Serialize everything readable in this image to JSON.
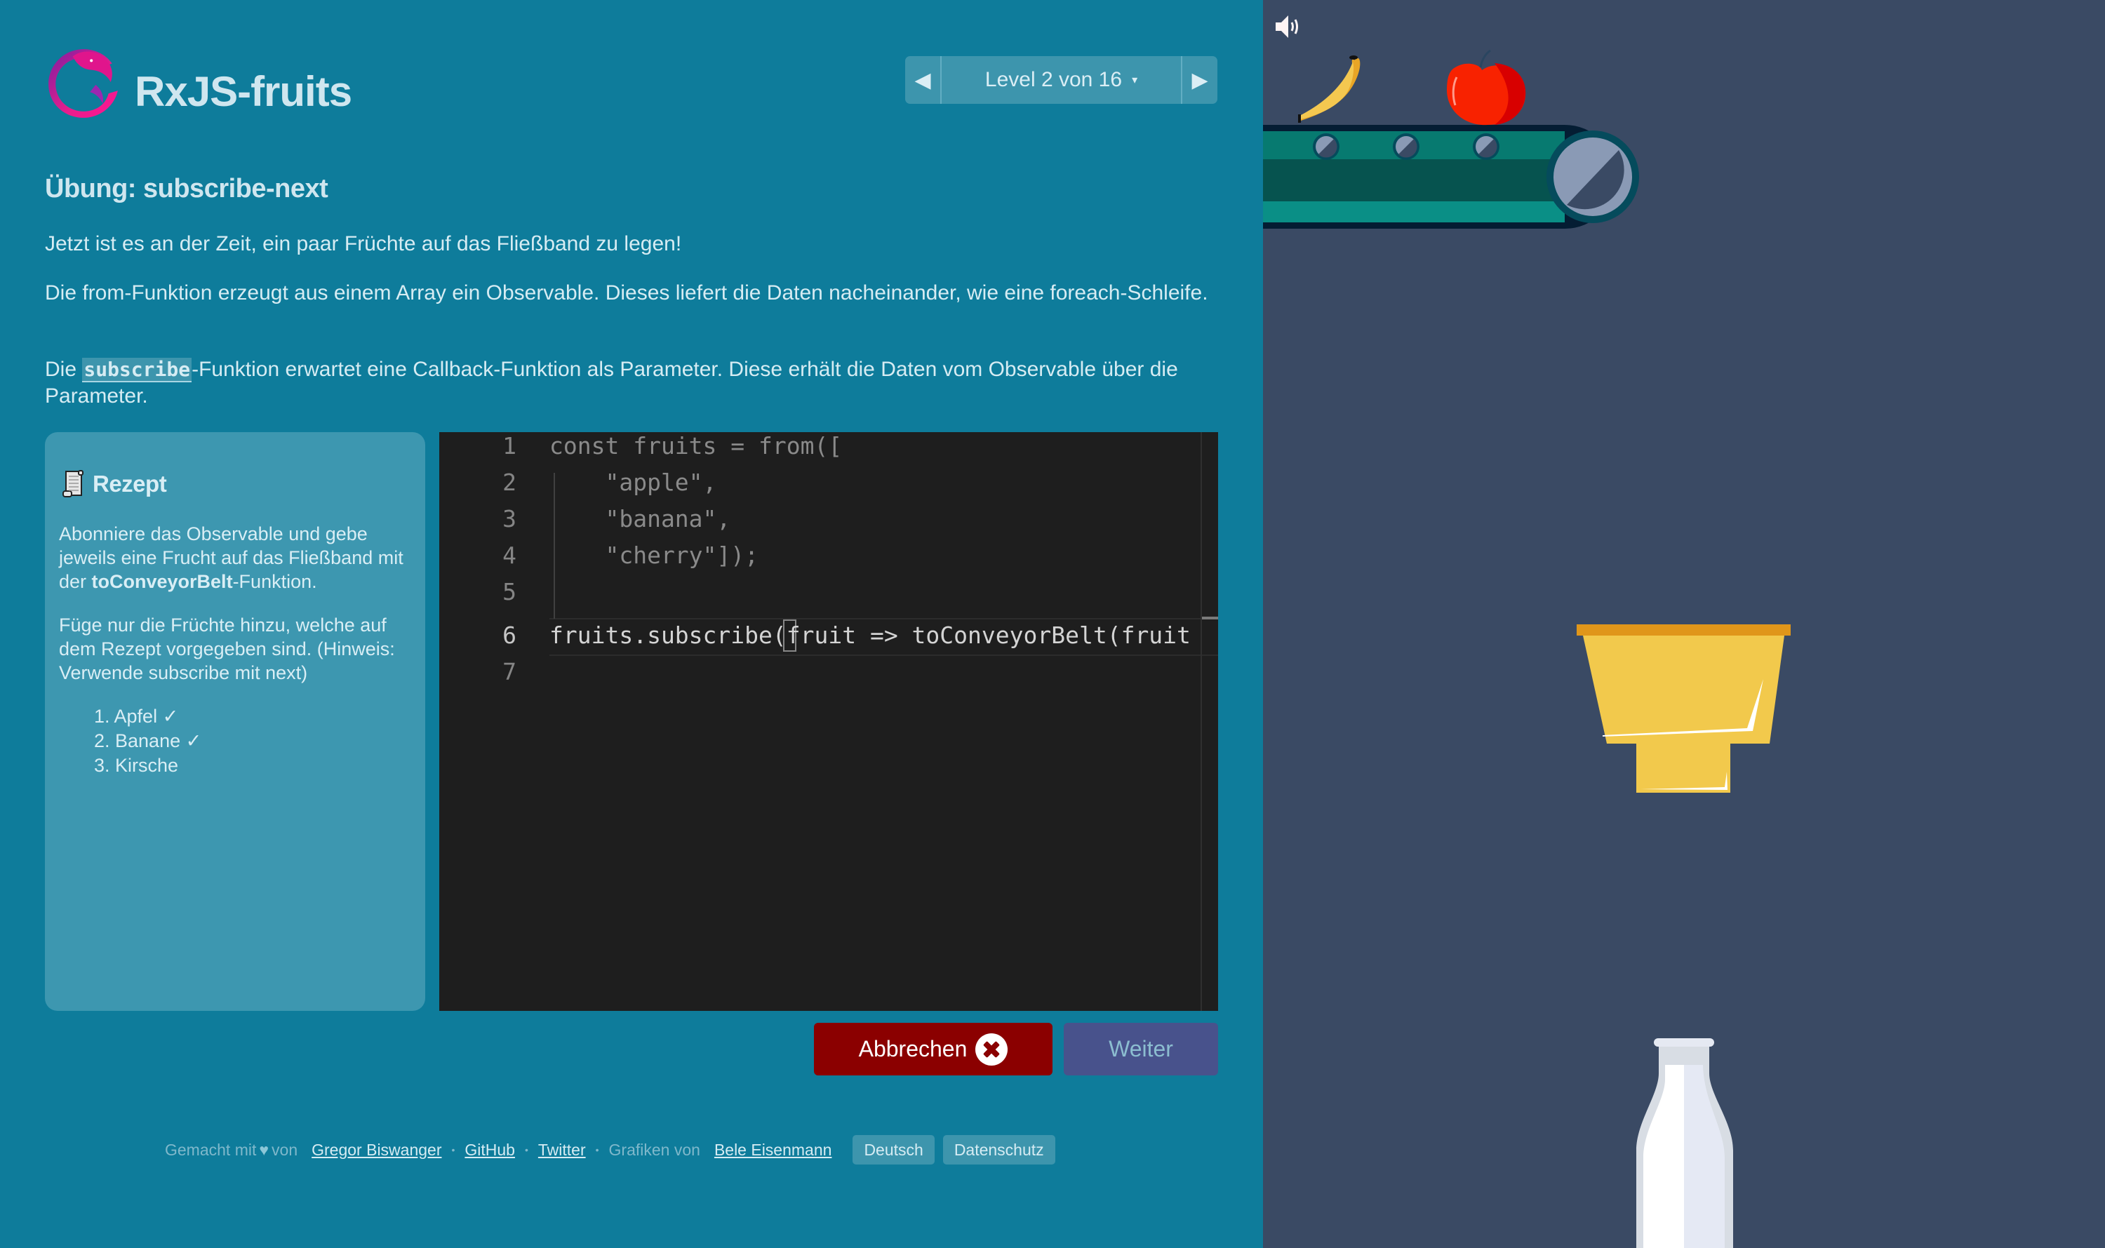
{
  "app": {
    "title": "RxJS-fruits",
    "logo": "rxjs-logo"
  },
  "level_selector": {
    "prev_icon": "triangle-left-icon",
    "label": "Level 2 von 16",
    "caret": "▾",
    "next_icon": "triangle-right-icon"
  },
  "exercise": {
    "title": "Übung: subscribe-next",
    "paragraph1": "Jetzt ist es an der Zeit, ein paar Früchte auf das Fließband zu legen!",
    "paragraph2": "Die from-Funktion erzeugt aus einem Array ein Observable. Dieses liefert die Daten nacheinander, wie eine foreach-Schleife.",
    "paragraph3_prefix": "Die ",
    "paragraph3_code": "subscribe",
    "paragraph3_suffix": "-Funktion erwartet eine Callback-Funktion als Parameter. Diese erhält die Daten vom Observable über die Parameter."
  },
  "recipe": {
    "icon": "scroll-icon",
    "title": "Rezept",
    "text1_prefix": "Abonniere das Observable und gebe jeweils eine Frucht auf das Fließband mit der ",
    "text1_bold": "toConveyorBelt",
    "text1_suffix": "-Funktion.",
    "text2": "Füge nur die Früchte hinzu, welche auf dem Rezept vorgegeben sind. (Hinweis: Verwende subscribe mit next)",
    "items": [
      {
        "label": "1. Apfel",
        "done": true,
        "mark": "✓"
      },
      {
        "label": "2. Banane",
        "done": true,
        "mark": "✓"
      },
      {
        "label": "3. Kirsche",
        "done": false,
        "mark": ""
      }
    ]
  },
  "editor": {
    "lines": [
      {
        "number": "1",
        "text": "const fruits = from(["
      },
      {
        "number": "2",
        "text": "    \"apple\","
      },
      {
        "number": "3",
        "text": "    \"banana\","
      },
      {
        "number": "4",
        "text": "    \"cherry\"]);"
      },
      {
        "number": "5",
        "text": ""
      },
      {
        "number": "6",
        "text": "fruits.subscribe(fruit => toConveyorBelt(fruit"
      },
      {
        "number": "7",
        "text": ""
      }
    ],
    "active_line": 6
  },
  "actions": {
    "cancel_label": "Abbrechen",
    "cancel_icon": "close-circle-icon",
    "next_label": "Weiter"
  },
  "footer": {
    "made_with": "Gemacht mit",
    "heart": "♥",
    "by": "von",
    "author": "Gregor Biswanger",
    "github": "GitHub",
    "twitter": "Twitter",
    "graphics_by": "Grafiken von",
    "artist": "Bele Eisenmann",
    "language_button": "Deutsch",
    "privacy_button": "Datenschutz",
    "separator": "•"
  },
  "game": {
    "sound_icon": "speaker-icon",
    "fruits_on_belt": [
      "banana",
      "apple"
    ],
    "colors": {
      "background": "#3a4a64",
      "belt_top": "#077a70",
      "belt_mid": "#06534f",
      "belt_bottom": "#0a8f86",
      "belt_frame": "#041d33",
      "roller": "#8a9ab5",
      "funnel": "#f2c94c",
      "funnel_rim": "#e0961a",
      "bottle": "#e5e9f2"
    }
  }
}
